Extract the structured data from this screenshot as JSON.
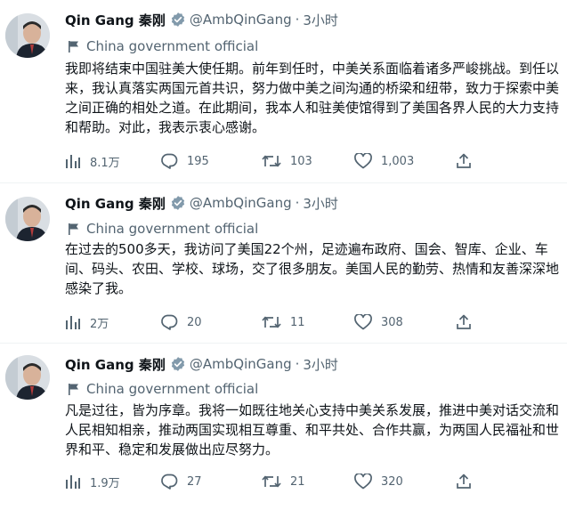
{
  "tweets": [
    {
      "name": "Qin Gang 秦刚",
      "handle": "@AmbQinGang",
      "time": "3小时",
      "label": "China government official",
      "text": "我即将结束中国驻美大使任期。前年到任时，中美关系面临着诸多严峻挑战。到任以来，我认真落实两国元首共识，努力做中美之间沟通的桥梁和纽带，致力于探索中美之间正确的相处之道。在此期间，我本人和驻美使馆得到了美国各界人民的大力支持和帮助。对此，我表示衷心感谢。",
      "views": "8.1万",
      "replies": "195",
      "retweets": "103",
      "likes": "1,003"
    },
    {
      "name": "Qin Gang 秦刚",
      "handle": "@AmbQinGang",
      "time": "3小时",
      "label": "China government official",
      "text": "在过去的500多天，我访问了美国22个州，足迹遍布政府、国会、智库、企业、车间、码头、农田、学校、球场，交了很多朋友。美国人民的勤劳、热情和友善深深地感染了我。",
      "views": "2万",
      "replies": "20",
      "retweets": "11",
      "likes": "308"
    },
    {
      "name": "Qin Gang 秦刚",
      "handle": "@AmbQinGang",
      "time": "3小时",
      "label": "China government official",
      "text": "凡是过往，皆为序章。我将一如既往地关心支持中美关系发展，推进中美对话交流和人民相知相亲，推动两国实现相互尊重、和平共处、合作共赢，为两国人民福祉和世界和平、稳定和发展做出应尽努力。",
      "views": "1.9万",
      "replies": "27",
      "retweets": "21",
      "likes": "320"
    }
  ],
  "icons": {
    "verified": "verified-badge-icon",
    "label": "flag-icon",
    "views": "analytics-icon",
    "reply": "reply-icon",
    "retweet": "retweet-icon",
    "like": "heart-icon",
    "share": "share-icon"
  },
  "colors": {
    "verified_badge": "#829aab",
    "secondary_text": "#536471",
    "primary_text": "#0f1419"
  }
}
